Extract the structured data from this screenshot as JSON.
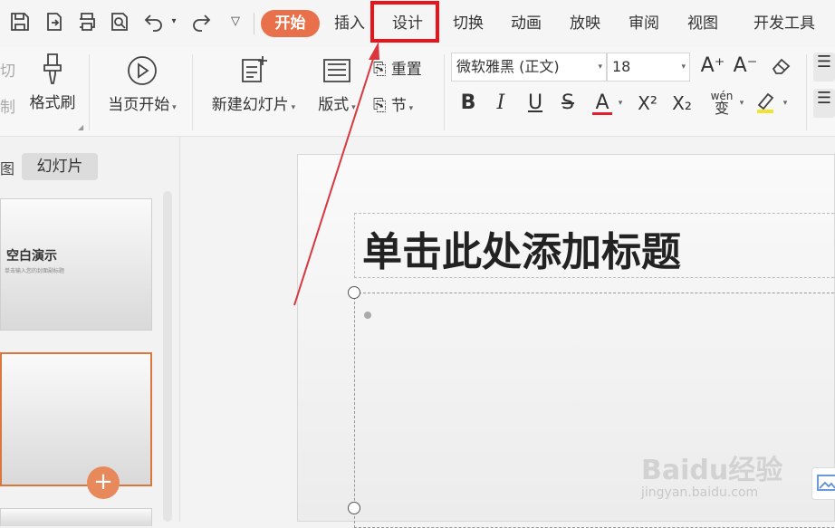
{
  "tabs": {
    "home": "开始",
    "insert": "插入",
    "design": "设计",
    "transition": "切换",
    "animation": "动画",
    "slideshow": "放映",
    "review": "审阅",
    "view": "视图",
    "developer": "开发工具"
  },
  "ribbon": {
    "cut_partial": "切",
    "copy_partial": "制",
    "format_painter": "格式刷",
    "play_from_current": "当页开始",
    "new_slide": "新建幻灯片",
    "layout": "版式",
    "reset": "重置",
    "section": "节",
    "font_name": "微软雅黑 (正文)",
    "font_size": "18",
    "font_color_letter": "A",
    "phonetic": "wén",
    "phonetic_char": "变"
  },
  "left_panel": {
    "tab_outline_partial": "图",
    "tab_slides": "幻灯片",
    "thumb1_title": "空白演示",
    "thumb1_subtitle": "单击输入您的封面副标题"
  },
  "slide": {
    "title_placeholder": "单击此处添加标题"
  },
  "watermark": {
    "brand": "Baidu经验",
    "url": "jingyan.baidu.com"
  },
  "colors": {
    "accent": "#e8704a",
    "highlight_box": "#e8141a",
    "arrow": "#d9363e"
  }
}
